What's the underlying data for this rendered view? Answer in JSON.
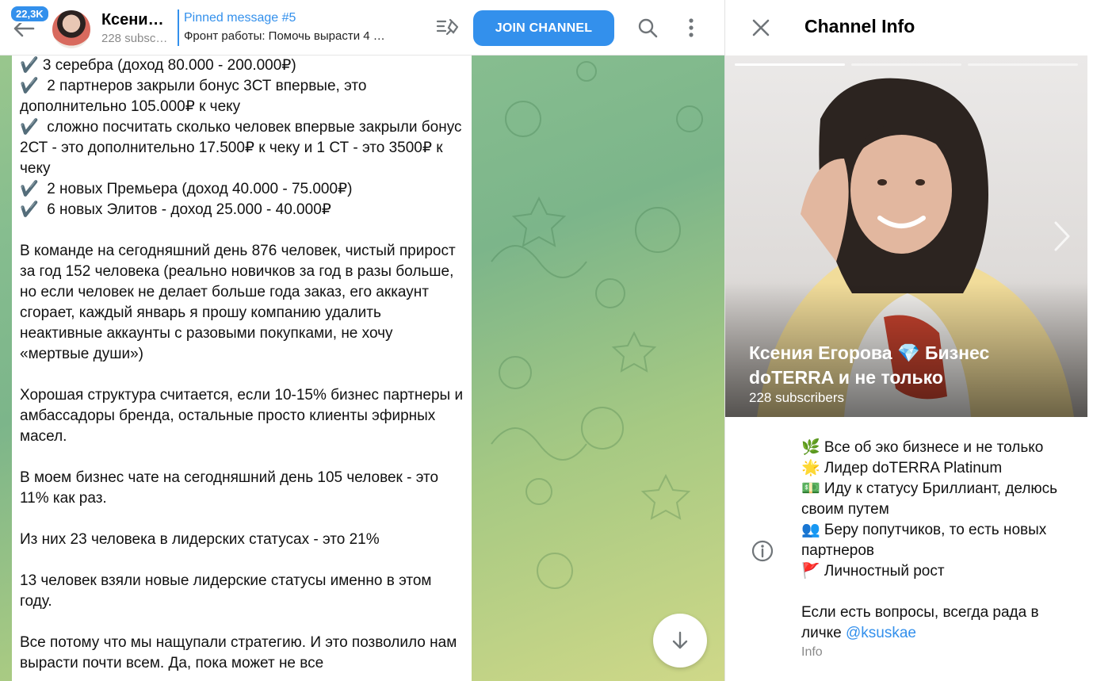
{
  "header": {
    "unread_badge": "22,3K",
    "channel_title": "Ксения Егорова 💎 Бизнес doTERRA и не только",
    "channel_subtitle": "228 subscribers",
    "pinned_title": "Pinned message #5",
    "pinned_text": "Фронт работы: Помочь вырасти 4 …",
    "join_label": "JOIN CHANNEL"
  },
  "message": {
    "lines": [
      "✔️ 3 серебра (доход 80.000 - 200.000₽)",
      "✔️  2 партнеров закрыли бонус 3СТ впервые, это дополнительно 105.000₽ к чеку",
      "✔️  сложно посчитать сколько человек впервые закрыли бонус 2СТ - это дополнительно 17.500₽ к чеку и 1 СТ - это 3500₽ к чеку",
      "✔️  2 новых Премьера (доход 40.000 - 75.000₽)",
      "✔️  6 новых Элитов - доход 25.000 - 40.000₽",
      "",
      "В команде на сегодняшний день 876 человек, чистый прирост за год 152 человека (реально новичков за год в разы больше, но если человек не делает больше года заказ, его аккаунт сгорает, каждый январь я прошу компанию удалить неактивные аккаунты с разовыми покупками, не хочу «мертвые души»)",
      "",
      "Хорошая структура считается, если 10-15% бизнес партнеры и амбассадоры бренда, остальные просто клиенты эфирных масел.",
      "",
      "В моем бизнес чате на сегодняшний день 105 человек - это 11% как раз.",
      "",
      "Из них 23 человека в лидерских статусах - это 21%",
      "",
      "13 человек взяли новые лидерские статусы именно в этом году.",
      "",
      "Все потому что мы нащупали стратегию. И это позволило нам вырасти почти всем. Да, пока может не все"
    ]
  },
  "info_panel": {
    "title": "Channel Info",
    "photo_name": "Ксения Егорова 💎 Бизнес doTERRA и не только",
    "photo_subscribers": "228 subscribers",
    "description": [
      "🌿 Все об эко бизнесе и не только",
      "🌟 Лидер doTERRA Platinum",
      "💵 Иду к статусу Бриллиант, делюсь своим путем",
      "👥 Беру попутчиков, то есть новых партнеров",
      "🚩 Личностный рост"
    ],
    "description_question": "Если есть вопросы, всегда рада в личке ",
    "description_link": "@ksuskae",
    "description_label": "Info"
  },
  "colors": {
    "accent": "#3390ec",
    "chat_bg_start": "#9fc98c",
    "chat_bg_end": "#cfd888"
  },
  "icons": [
    "back-arrow-icon",
    "pinned-list-icon",
    "search-icon",
    "more-vertical-icon",
    "arrow-down-icon",
    "close-icon",
    "info-circle-icon",
    "chevron-right-icon"
  ]
}
